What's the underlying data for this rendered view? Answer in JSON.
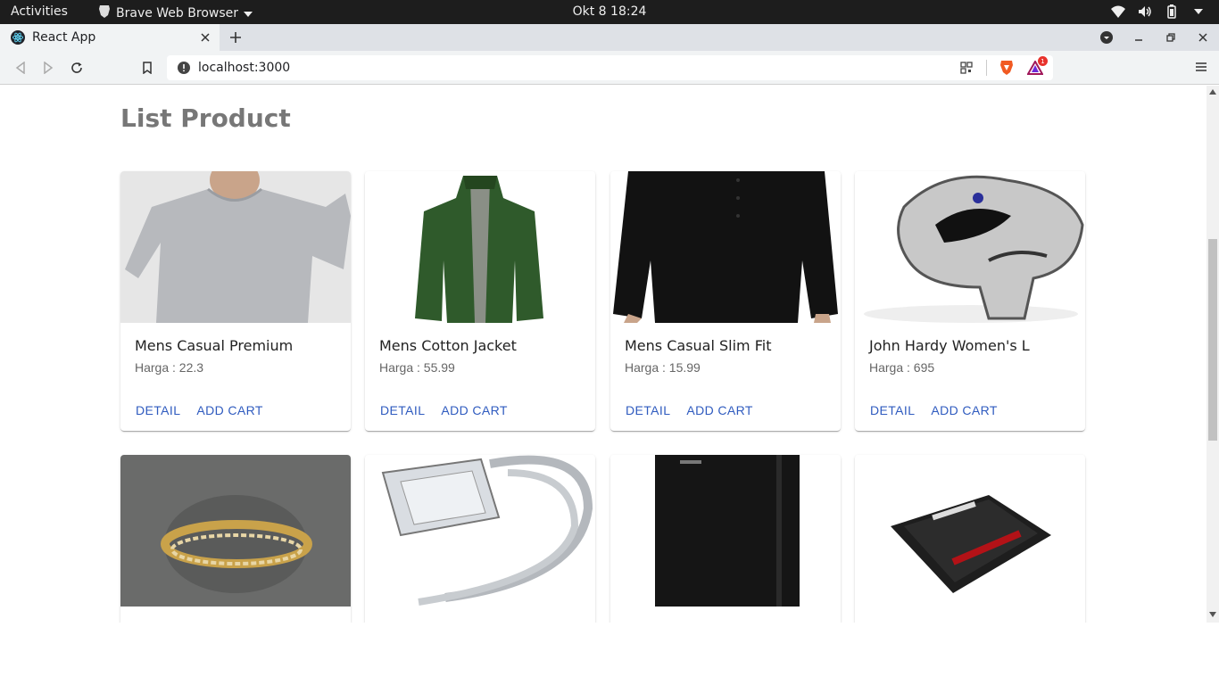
{
  "system": {
    "activities": "Activities",
    "app_menu": "Brave Web Browser",
    "clock": "Okt 8  18:24"
  },
  "browser": {
    "tab_title": "React App",
    "url": "localhost:3000",
    "shields_badge": "1"
  },
  "page": {
    "title": "List Product",
    "price_prefix": "Harga : ",
    "buttons": {
      "detail": "DETAIL",
      "add_cart": "ADD CART"
    },
    "products": [
      {
        "name": "Mens Casual Premium",
        "price": "Harga : 22.3",
        "image": "grey-sweater"
      },
      {
        "name": "Mens Cotton Jacket",
        "price": "Harga : 55.99",
        "image": "green-jacket"
      },
      {
        "name": "Mens Casual Slim Fit",
        "price": "Harga : 15.99",
        "image": "black-longsleeve"
      },
      {
        "name": "John Hardy Women's L",
        "price": "Harga : 695",
        "image": "dragon-ring"
      },
      {
        "name": "",
        "price": "",
        "image": "gold-pearl-ring"
      },
      {
        "name": "",
        "price": "",
        "image": "diamond-ring"
      },
      {
        "name": "",
        "price": "",
        "image": "black-hard-drive"
      },
      {
        "name": "",
        "price": "",
        "image": "sandisk-ssd"
      }
    ]
  },
  "colors": {
    "link": "#2f5bbf",
    "title": "#777777",
    "topbar": "#1d1d1d"
  }
}
